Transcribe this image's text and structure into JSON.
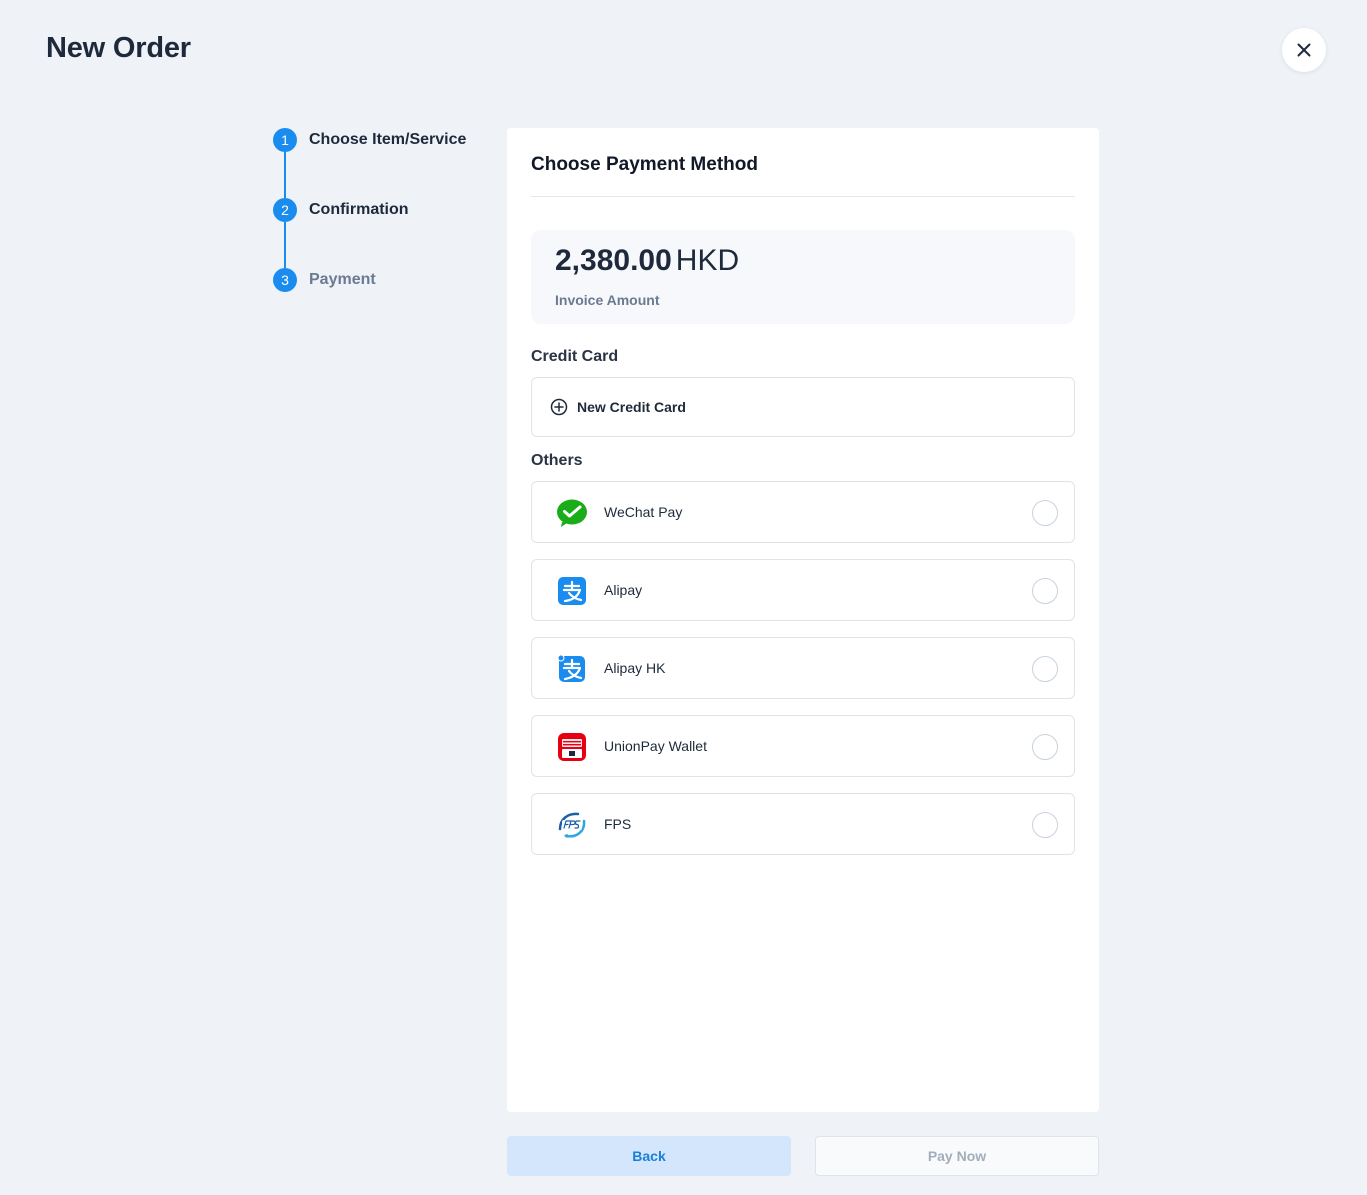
{
  "page": {
    "title": "New Order",
    "close_icon": "close-icon"
  },
  "stepper": {
    "accent_color": "#1a8cf0",
    "steps": [
      {
        "number": "1",
        "label": "Choose Item/Service"
      },
      {
        "number": "2",
        "label": "Confirmation"
      },
      {
        "number": "3",
        "label": "Payment"
      }
    ]
  },
  "payment": {
    "title": "Choose Payment Method",
    "amount": {
      "value": "2,380.00",
      "currency": "HKD",
      "label": "Invoice Amount"
    },
    "credit_card": {
      "section_label": "Credit Card",
      "new_card_label": "New Credit Card",
      "new_card_icon": "plus-circle-icon"
    },
    "others": {
      "section_label": "Others",
      "methods": [
        {
          "label": "WeChat Pay",
          "icon": "wechat-pay-icon",
          "selected": false
        },
        {
          "label": "Alipay",
          "icon": "alipay-icon",
          "selected": false
        },
        {
          "label": "Alipay HK",
          "icon": "alipay-hk-icon",
          "selected": false
        },
        {
          "label": "UnionPay Wallet",
          "icon": "unionpay-wallet-icon",
          "selected": false
        },
        {
          "label": "FPS",
          "icon": "fps-icon",
          "selected": false
        }
      ]
    }
  },
  "actions": {
    "back_label": "Back",
    "pay_label": "Pay Now"
  },
  "colors": {
    "background": "#eff3f8",
    "primary": "#1a8cf0",
    "wechat": "#1aad19",
    "alipay": "#1677ff",
    "unionpay": "#e60012"
  }
}
